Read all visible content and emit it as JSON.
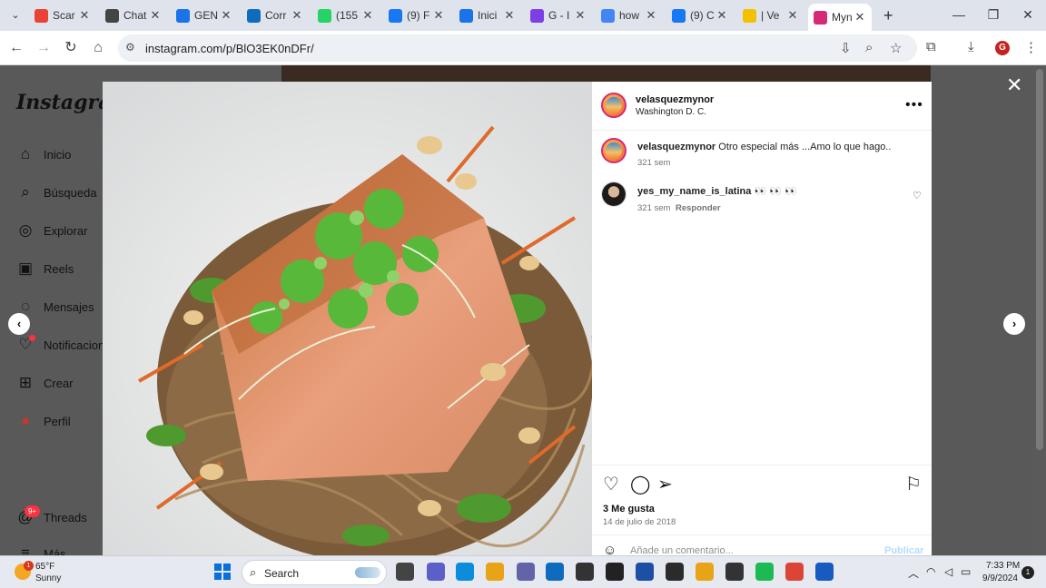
{
  "browser": {
    "tabs": [
      {
        "title": "Scar",
        "icon": "gmail-icon",
        "color": "#ea4335"
      },
      {
        "title": "Chat",
        "icon": "chatgpt-icon",
        "color": "#444444"
      },
      {
        "title": "GEN",
        "icon": "edge-copilot-icon",
        "color": "#1a73e8"
      },
      {
        "title": "Corr",
        "icon": "outlook-icon",
        "color": "#0f6cbd"
      },
      {
        "title": "(155",
        "icon": "whatsapp-icon",
        "color": "#25d366"
      },
      {
        "title": "(9) F",
        "icon": "facebook-icon",
        "color": "#1877f2"
      },
      {
        "title": "Inici",
        "icon": "edge-copilot-icon",
        "color": "#1a73e8"
      },
      {
        "title": "G - I",
        "icon": "shield-icon",
        "color": "#7b3fe4"
      },
      {
        "title": "how",
        "icon": "google-icon",
        "color": "#4285f4"
      },
      {
        "title": "(9) C",
        "icon": "facebook-icon",
        "color": "#1877f2"
      },
      {
        "title": "| Ve",
        "icon": "grid-icon",
        "color": "#f2c200"
      },
      {
        "title": "Myn",
        "icon": "instagram-icon",
        "color": "#d62976"
      }
    ],
    "url": "instagram.com/p/BlO3EK0nDFr/"
  },
  "sidebar": {
    "logo": "Instagram",
    "items": [
      {
        "label": "Inicio",
        "icon": "home-icon"
      },
      {
        "label": "Búsqueda",
        "icon": "search-icon"
      },
      {
        "label": "Explorar",
        "icon": "compass-icon"
      },
      {
        "label": "Reels",
        "icon": "reels-icon"
      },
      {
        "label": "Mensajes",
        "icon": "messenger-icon"
      },
      {
        "label": "Notificaciones",
        "icon": "heart-icon"
      },
      {
        "label": "Crear",
        "icon": "plus-square-icon"
      },
      {
        "label": "Perfil",
        "icon": "profile-avatar-icon"
      },
      {
        "label": "Threads",
        "icon": "threads-icon",
        "badge": "9+"
      },
      {
        "label": "Más",
        "icon": "menu-icon"
      }
    ]
  },
  "post": {
    "author": "velasquezmynor",
    "location": "Washington D. C.",
    "caption": {
      "username": "velasquezmynor",
      "text": "Otro especial más ...Amo lo que hago..",
      "age": "321 sem"
    },
    "comments": [
      {
        "username": "yes_my_name_is_latina",
        "text": "👀 👀 👀",
        "age": "321 sem",
        "reply_label": "Responder"
      }
    ],
    "likes": "3 Me gusta",
    "date": "14 de julio de 2018",
    "comment_placeholder": "Añade un comentario...",
    "publish_label": "Publicar"
  },
  "taskbar": {
    "temperature": "65°F",
    "condition": "Sunny",
    "weather_badge": "1",
    "search_label": "Search",
    "time": "7:33 PM",
    "date": "9/9/2024",
    "notification_count": "1",
    "apps": [
      {
        "icon": "file-explorer-tb-icon",
        "color": "#444444"
      },
      {
        "icon": "teams-icon",
        "color": "#5b5fc7"
      },
      {
        "icon": "edge-icon",
        "color": "#0c8ddb"
      },
      {
        "icon": "folder-icon",
        "color": "#e8a317"
      },
      {
        "icon": "teams-chat-icon",
        "color": "#6264a7"
      },
      {
        "icon": "mail-icon",
        "color": "#0f6cbd"
      },
      {
        "icon": "dropbox-icon",
        "color": "#333333"
      },
      {
        "icon": "terminal-icon",
        "color": "#222222"
      },
      {
        "icon": "store-icon",
        "color": "#1d4fa3"
      },
      {
        "icon": "lightning-icon",
        "color": "#2b2b2b"
      },
      {
        "icon": "puzzle-app-icon",
        "color": "#e8a317"
      },
      {
        "icon": "notes-icon",
        "color": "#333333"
      },
      {
        "icon": "spotify-icon",
        "color": "#1db954"
      },
      {
        "icon": "chrome-icon",
        "color": "#db4437"
      },
      {
        "icon": "word-icon",
        "color": "#185abd"
      }
    ]
  }
}
